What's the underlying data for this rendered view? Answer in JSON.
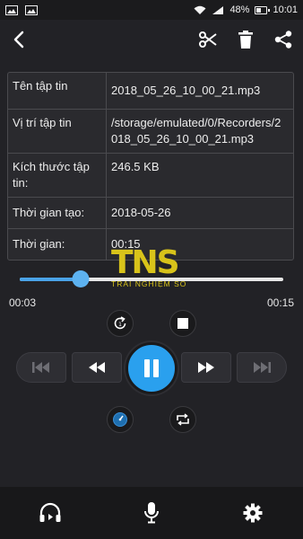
{
  "status_bar": {
    "battery_percent": "48%",
    "battery_level": 0.48,
    "time": "10:01"
  },
  "toolbar": {
    "back_icon": "back-arrow-icon",
    "actions": [
      "scissors-icon",
      "trash-icon",
      "share-icon"
    ]
  },
  "file_info": {
    "rows": [
      {
        "label": "Tên tập tin",
        "value": "2018_05_26_10_00_21.mp3"
      },
      {
        "label": "Vị trí tập tin",
        "value": "/storage/emulated/0/Recorders/2018_05_26_10_00_21.mp3"
      },
      {
        "label": "Kích thước tập tin:",
        "value": "246.5 KB"
      },
      {
        "label": "Thời gian tạo:",
        "value": "2018-05-26"
      },
      {
        "label": "Thời gian:",
        "value": "00:15"
      }
    ]
  },
  "watermark": {
    "logo": "TNS",
    "tagline": "TRẢI NGHIỆM SỐ"
  },
  "player": {
    "current_time": "00:03",
    "total_time": "00:15",
    "progress": 0.23,
    "accent_color": "#2aa0ee"
  },
  "bottom_nav": [
    "headphones-icon",
    "microphone-icon",
    "settings-icon"
  ]
}
